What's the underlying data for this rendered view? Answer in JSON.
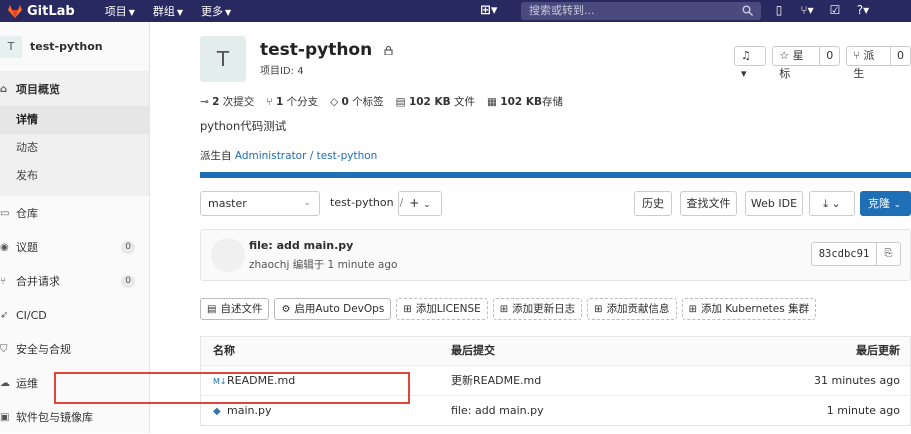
{
  "topbar": {
    "brand": "GitLab",
    "menu": [
      {
        "label": "项目"
      },
      {
        "label": "群组"
      },
      {
        "label": "更多"
      }
    ],
    "search_placeholder": "搜索或转到..."
  },
  "sidebar": {
    "project_avatar": "T",
    "project_name": "test-python",
    "overview": "项目概览",
    "overview_sub": [
      "详情",
      "动态",
      "发布"
    ],
    "items": [
      {
        "label": "仓库",
        "count": ""
      },
      {
        "label": "议题",
        "count": "0"
      },
      {
        "label": "合并请求",
        "count": "0"
      },
      {
        "label": "CI/CD",
        "count": ""
      },
      {
        "label": "安全与合规",
        "count": ""
      },
      {
        "label": "运维",
        "count": ""
      },
      {
        "label": "软件包与镜像库",
        "count": ""
      }
    ]
  },
  "project": {
    "avatar": "T",
    "title": "test-python",
    "id_label": "项目ID: 4",
    "notify_label": "♫",
    "star_label": "星标",
    "star_count": "0",
    "fork_label": "派生",
    "fork_count": "0",
    "stats": {
      "commits": "2",
      "commits_label": "次提交",
      "branches": "1",
      "branches_label": "个分支",
      "tags": "0",
      "tags_label": "个标签",
      "files": "102 KB",
      "files_label": "文件",
      "storage": "102 KB",
      "storage_label": "存储"
    },
    "description": "python代码测试",
    "forked_from_prefix": "派生自",
    "forked_from": "Administrator / test-python",
    "progress": 1.0
  },
  "branch_bar": {
    "branch": "master",
    "path": "test-python",
    "path_sep": "/",
    "add_label": "+",
    "history": "历史",
    "find_file": "查找文件",
    "web_ide": "Web IDE",
    "clone": "克隆"
  },
  "last_commit": {
    "title": "file: add main.py",
    "meta": "zhaochj 编辑于 1 minute ago",
    "sha": "83cdbc91"
  },
  "quick_actions": [
    {
      "label": "自述文件",
      "dashed": false,
      "icon": "document-icon"
    },
    {
      "label": "启用Auto DevOps",
      "dashed": false,
      "icon": "gear-icon"
    },
    {
      "label": "添加LICENSE",
      "dashed": true,
      "icon": "plus-square-icon"
    },
    {
      "label": "添加更新日志",
      "dashed": true,
      "icon": "plus-square-icon"
    },
    {
      "label": "添加贡献信息",
      "dashed": true,
      "icon": "plus-square-icon"
    },
    {
      "label": "添加 Kubernetes 集群",
      "dashed": true,
      "icon": "plus-square-icon"
    }
  ],
  "file_table": {
    "headers": [
      "名称",
      "最后提交",
      "最后更新"
    ],
    "rows": [
      {
        "name": "README.md",
        "commit": "更新README.md",
        "updated": "31 minutes ago",
        "icon": "markdown-icon"
      },
      {
        "name": "main.py",
        "commit": "file: add main.py",
        "updated": "1 minute ago",
        "icon": "python-icon"
      }
    ]
  },
  "colors": {
    "nav_bg": "#292961",
    "accent": "#1f6fb6",
    "highlight": "#e0443a"
  }
}
